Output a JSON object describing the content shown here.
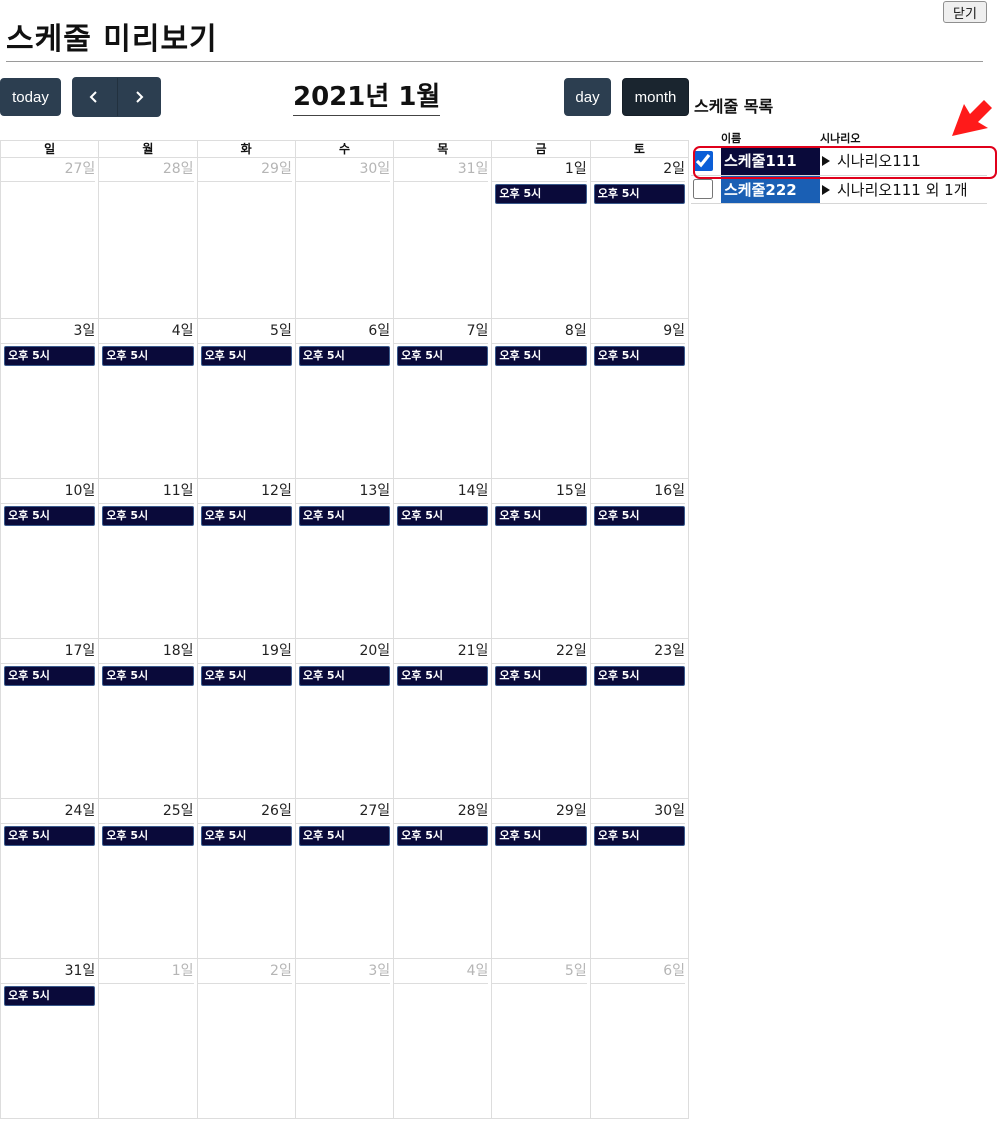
{
  "header": {
    "title": "스케줄 미리보기",
    "close_label": "닫기"
  },
  "toolbar": {
    "today_label": "today",
    "prev_icon": "chevron-left-icon",
    "next_icon": "chevron-right-icon",
    "calendar_title": "2021년 1월",
    "day_label": "day",
    "month_label": "month",
    "active_view": "month"
  },
  "calendar": {
    "weekdays": [
      "일",
      "월",
      "화",
      "수",
      "목",
      "금",
      "토"
    ],
    "weeks": [
      [
        {
          "label": "27일",
          "other": true,
          "event": ""
        },
        {
          "label": "28일",
          "other": true,
          "event": ""
        },
        {
          "label": "29일",
          "other": true,
          "event": ""
        },
        {
          "label": "30일",
          "other": true,
          "event": ""
        },
        {
          "label": "31일",
          "other": true,
          "event": ""
        },
        {
          "label": "1일",
          "other": false,
          "event": "오후 5시"
        },
        {
          "label": "2일",
          "other": false,
          "event": "오후 5시"
        }
      ],
      [
        {
          "label": "3일",
          "other": false,
          "event": "오후 5시"
        },
        {
          "label": "4일",
          "other": false,
          "event": "오후 5시"
        },
        {
          "label": "5일",
          "other": false,
          "event": "오후 5시"
        },
        {
          "label": "6일",
          "other": false,
          "event": "오후 5시"
        },
        {
          "label": "7일",
          "other": false,
          "event": "오후 5시"
        },
        {
          "label": "8일",
          "other": false,
          "event": "오후 5시"
        },
        {
          "label": "9일",
          "other": false,
          "event": "오후 5시"
        }
      ],
      [
        {
          "label": "10일",
          "other": false,
          "event": "오후 5시"
        },
        {
          "label": "11일",
          "other": false,
          "event": "오후 5시"
        },
        {
          "label": "12일",
          "other": false,
          "event": "오후 5시"
        },
        {
          "label": "13일",
          "other": false,
          "event": "오후 5시"
        },
        {
          "label": "14일",
          "other": false,
          "event": "오후 5시"
        },
        {
          "label": "15일",
          "other": false,
          "event": "오후 5시"
        },
        {
          "label": "16일",
          "other": false,
          "event": "오후 5시"
        }
      ],
      [
        {
          "label": "17일",
          "other": false,
          "event": "오후 5시"
        },
        {
          "label": "18일",
          "other": false,
          "event": "오후 5시"
        },
        {
          "label": "19일",
          "other": false,
          "event": "오후 5시"
        },
        {
          "label": "20일",
          "other": false,
          "event": "오후 5시"
        },
        {
          "label": "21일",
          "other": false,
          "event": "오후 5시"
        },
        {
          "label": "22일",
          "other": false,
          "event": "오후 5시"
        },
        {
          "label": "23일",
          "other": false,
          "event": "오후 5시"
        }
      ],
      [
        {
          "label": "24일",
          "other": false,
          "event": "오후 5시"
        },
        {
          "label": "25일",
          "other": false,
          "event": "오후 5시"
        },
        {
          "label": "26일",
          "other": false,
          "event": "오후 5시"
        },
        {
          "label": "27일",
          "other": false,
          "event": "오후 5시"
        },
        {
          "label": "28일",
          "other": false,
          "event": "오후 5시"
        },
        {
          "label": "29일",
          "other": false,
          "event": "오후 5시"
        },
        {
          "label": "30일",
          "other": false,
          "event": "오후 5시"
        }
      ],
      [
        {
          "label": "31일",
          "other": false,
          "event": "오후 5시"
        },
        {
          "label": "1일",
          "other": true,
          "event": ""
        },
        {
          "label": "2일",
          "other": true,
          "event": ""
        },
        {
          "label": "3일",
          "other": true,
          "event": ""
        },
        {
          "label": "4일",
          "other": true,
          "event": ""
        },
        {
          "label": "5일",
          "other": true,
          "event": ""
        },
        {
          "label": "6일",
          "other": true,
          "event": ""
        }
      ]
    ]
  },
  "schedule_list": {
    "title": "스케줄 목록",
    "columns": [
      "이름",
      "시나리오"
    ],
    "rows": [
      {
        "checked": true,
        "name": "스케줄111",
        "scenario": "시나리오111",
        "color": "#0a0a3a"
      },
      {
        "checked": false,
        "name": "스케줄222",
        "scenario": "시나리오111 외 1개",
        "color": "#1a5fb4"
      }
    ]
  },
  "colors": {
    "button_bg": "#2c3e50",
    "event_bg": "#0a0a3a",
    "highlight": "#e0001b",
    "checkbox_accent": "#0b5ed7"
  }
}
